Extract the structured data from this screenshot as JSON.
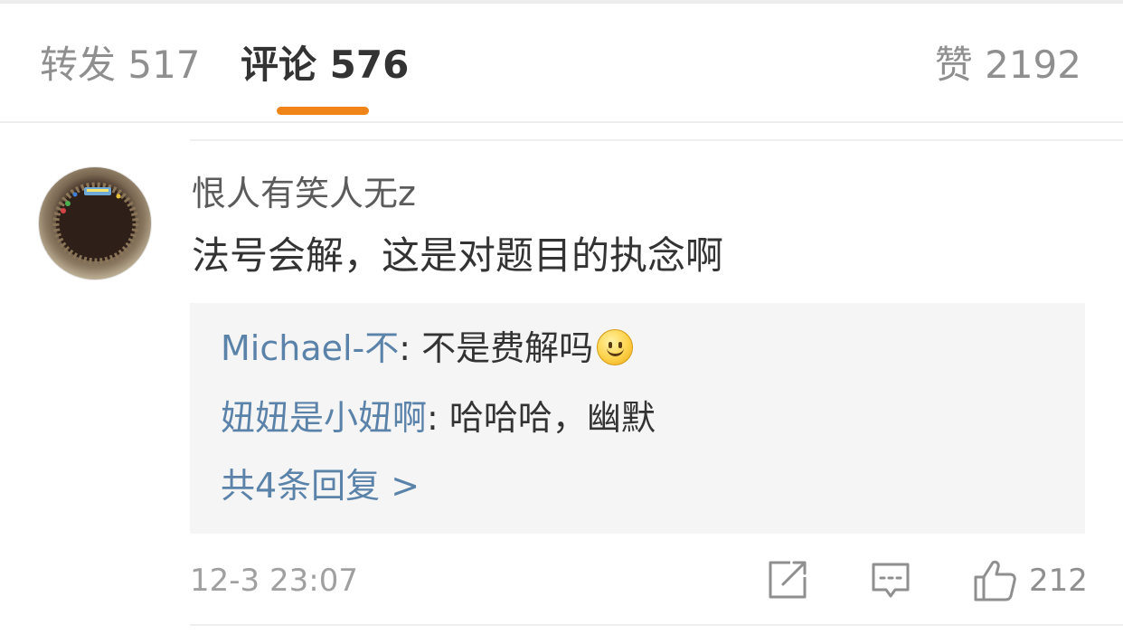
{
  "tabs": {
    "repost": "转发 517",
    "comment": "评论 576",
    "like": "赞 2192"
  },
  "comment": {
    "username": "恨人有笑人无z",
    "text": "法号会解，这是对题目的执念啊",
    "timestamp": "12-3 23:07",
    "like_count": "212",
    "avatar_icon": "birthday-cake-photo"
  },
  "replies": [
    {
      "name": "Michael-不",
      "separator": ": ",
      "text": "不是费解吗",
      "emoji": "smile-emoji"
    },
    {
      "name": "妞妞是小妞啊",
      "separator": ": ",
      "text": "哈哈哈，幽默"
    }
  ],
  "more_replies": "共4条回复 >",
  "colors": {
    "accent_underline": "#f08418",
    "link_blue": "#5b83aa",
    "reply_bg": "#f5f5f5"
  }
}
